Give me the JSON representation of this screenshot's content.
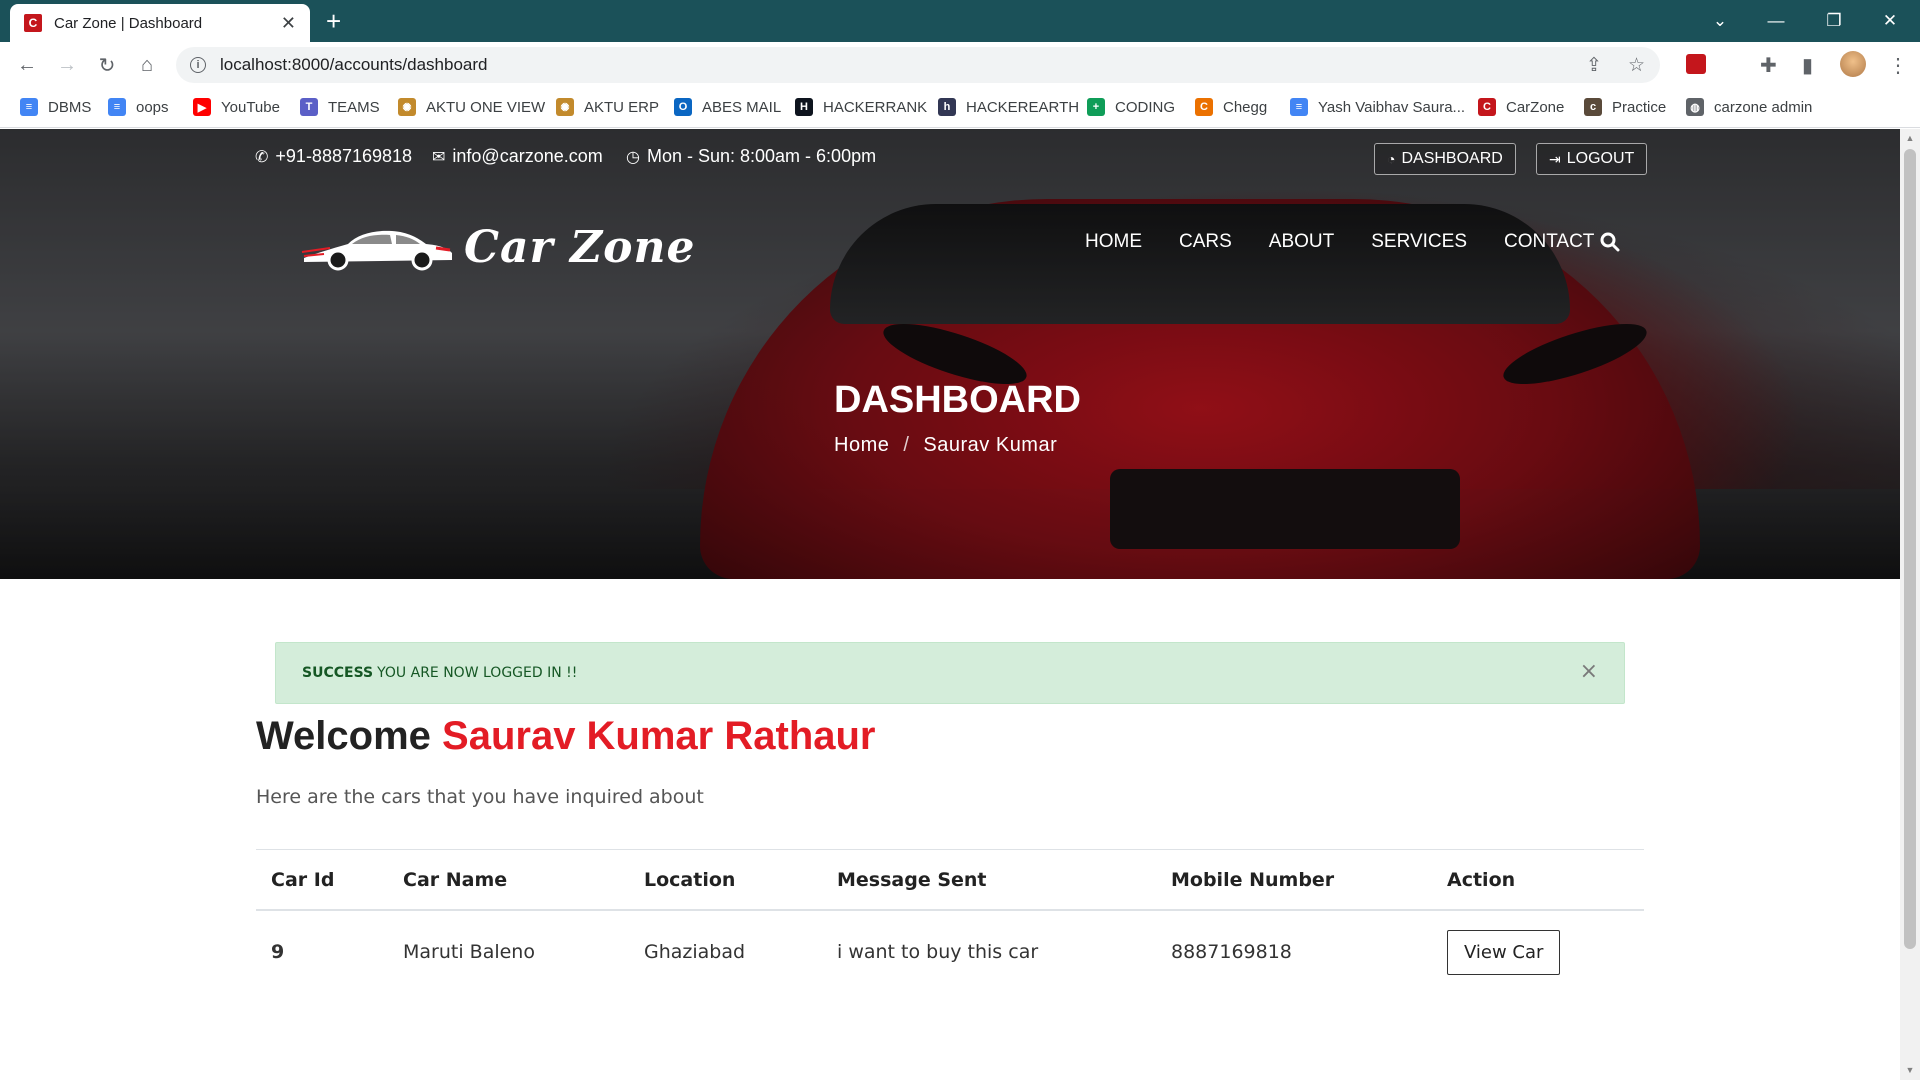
{
  "browser": {
    "tab_title": "Car Zone | Dashboard",
    "tab_favicon": "C",
    "url": "localhost:8000/accounts/dashboard",
    "bookmarks": [
      {
        "label": "DBMS",
        "color": "#4285f4",
        "icon": "doc-icon"
      },
      {
        "label": "oops",
        "color": "#4285f4",
        "icon": "doc-icon"
      },
      {
        "label": "YouTube",
        "color": "#ff0000",
        "icon": "youtube-icon"
      },
      {
        "label": "TEAMS",
        "color": "#5b5fc7",
        "icon": "teams-icon"
      },
      {
        "label": "AKTU ONE VIEW",
        "color": "#c28a2c",
        "icon": "seal-icon"
      },
      {
        "label": "AKTU ERP",
        "color": "#c28a2c",
        "icon": "seal-icon"
      },
      {
        "label": "ABES MAIL",
        "color": "#0a66c2",
        "icon": "outlook-icon"
      },
      {
        "label": "HACKERRANK",
        "color": "#0e141e",
        "icon": "hackerrank-icon"
      },
      {
        "label": "HACKEREARTH",
        "color": "#323754",
        "icon": "hackerearth-icon"
      },
      {
        "label": "CODING",
        "color": "#0f9d58",
        "icon": "sheet-icon"
      },
      {
        "label": "Chegg",
        "color": "#eb7100",
        "icon": "chegg-icon"
      },
      {
        "label": "Yash Vaibhav Saura...",
        "color": "#4285f4",
        "icon": "doc-icon"
      },
      {
        "label": "CarZone",
        "color": "#c4161c",
        "icon": "carzone-icon"
      },
      {
        "label": "Practice",
        "color": "#5a4a3a",
        "icon": "codechef-icon"
      },
      {
        "label": "carzone admin",
        "color": "#5f6368",
        "icon": "globe-icon"
      }
    ]
  },
  "site": {
    "phone": "+91-8887169818",
    "email": "info@carzone.com",
    "hours": "Mon - Sun: 8:00am - 6:00pm",
    "dashboard_btn": "DASHBOARD",
    "logout_btn": "LOGOUT",
    "brand": "Car Zone",
    "nav": [
      "HOME",
      "CARS",
      "ABOUT",
      "SERVICES",
      "CONTACT"
    ],
    "hero_title": "DASHBOARD",
    "breadcrumb": {
      "home": "Home",
      "sep": "/",
      "current": "Saurav Kumar"
    }
  },
  "content": {
    "alert": {
      "strong": "SUCCESS",
      "text": "YOU ARE NOW LOGGED IN !!",
      "close": "×"
    },
    "welcome_prefix": "Welcome",
    "user_name": "Saurav Kumar Rathaur",
    "subtitle": "Here are the cars that you have inquired about",
    "table": {
      "headers": [
        "Car Id",
        "Car Name",
        "Location",
        "Message Sent",
        "Mobile Number",
        "Action"
      ],
      "rows": [
        {
          "id": "9",
          "name": "Maruti Baleno",
          "location": "Ghaziabad",
          "message": "i want to buy this car",
          "mobile": "8887169818",
          "action": "View Car"
        }
      ]
    }
  },
  "colors": {
    "accent": "#e31c25",
    "tabbar": "#1b5159",
    "alert_bg": "#d4edda",
    "alert_text": "#155724"
  }
}
